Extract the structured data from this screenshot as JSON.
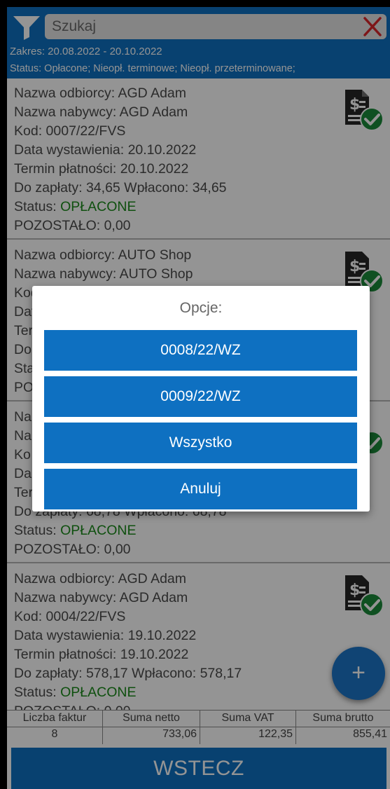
{
  "header": {
    "search_placeholder": "Szukaj",
    "range_text": "Zakres: 20.08.2022  -  20.10.2022",
    "status_text": "Status:  Opłacone; Nieopł. terminowe; Nieopł. przeterminowane;"
  },
  "invoices": [
    {
      "recipient": "Nazwa odbiorcy: AGD Adam",
      "buyer": "Nazwa nabywcy: AGD Adam",
      "code": "Kod:  0007/22/FVS",
      "issue_date": "Data wystawienia:  20.10.2022",
      "due_date": "Termin płatności:  20.10.2022",
      "amounts": "Do zapłaty: 34,65  Wpłacono:  34,65",
      "status_label": "Status:  ",
      "status_value": "OPŁACONE",
      "remaining": "POZOSTAŁO:  0,00"
    },
    {
      "recipient": "Nazwa odbiorcy: AUTO Shop",
      "buyer": "Nazwa nabywcy: AUTO Shop",
      "code": "Kod",
      "issue_date": "Dat",
      "due_date": "Ter",
      "amounts": "Do",
      "status_label": "Sta",
      "status_value": "",
      "remaining": "PO"
    },
    {
      "recipient": "Na",
      "buyer": "Na",
      "code": "Ko",
      "issue_date": "Da",
      "due_date": "Ter",
      "amounts": "Do zapłaty: 68,78  Wpłacono:  68,78",
      "status_label": "Status:  ",
      "status_value": "OPŁACONE",
      "remaining": "POZOSTAŁO:  0,00"
    },
    {
      "recipient": "Nazwa odbiorcy: AGD Adam",
      "buyer": "Nazwa nabywcy: AGD Adam",
      "code": "Kod:  0004/22/FVS",
      "issue_date": "Data wystawienia:  19.10.2022",
      "due_date": "Termin płatności:  19.10.2022",
      "amounts": "Do zapłaty: 578,17  Wpłacono:  578,17",
      "status_label": "Status:  ",
      "status_value": "OPŁACONE",
      "remaining": "POZOSTAŁO:  0,00"
    }
  ],
  "fab": {
    "label": "+"
  },
  "summary": {
    "count_header": "Liczba faktur",
    "net_header": "Suma netto",
    "vat_header": "Suma VAT",
    "gross_header": "Suma brutto",
    "count": "8",
    "net": "733,06",
    "vat": "122,35",
    "gross": "855,41"
  },
  "back_label": "WSTECZ",
  "dialog": {
    "title": "Opcje:",
    "options": [
      "0008/22/WZ",
      "0009/22/WZ",
      "Wszystko",
      "Anuluj"
    ]
  },
  "colors": {
    "primary": "#0e70c1",
    "paid_status": "#1a8a1a",
    "check_badge": "#1a8a3a"
  }
}
